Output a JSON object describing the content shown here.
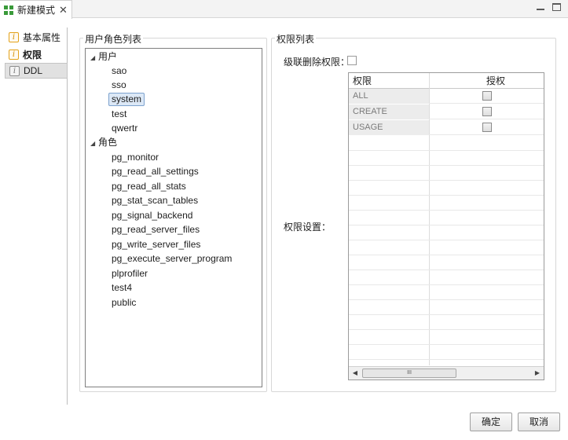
{
  "tab": {
    "title": "新建模式",
    "close": "✕"
  },
  "nav": {
    "items": [
      {
        "label": "基本属性"
      },
      {
        "label": "权限"
      },
      {
        "label": "DDL"
      }
    ]
  },
  "user_role_panel": {
    "title": "用户角色列表",
    "users_label": "用户",
    "users": [
      "sao",
      "sso",
      "system",
      "test",
      "qwertr"
    ],
    "selected_user": "system",
    "roles_label": "角色",
    "roles": [
      "pg_monitor",
      "pg_read_all_settings",
      "pg_read_all_stats",
      "pg_stat_scan_tables",
      "pg_signal_backend",
      "pg_read_server_files",
      "pg_write_server_files",
      "pg_execute_server_program",
      "plprofiler",
      "test4",
      "public"
    ]
  },
  "perm_panel": {
    "title": "权限列表",
    "cascade_label": "级联删除权限：",
    "cascade_checked": false,
    "settings_label": "权限设置：",
    "columns": [
      "权限",
      "授权"
    ],
    "rows": [
      {
        "name": "ALL",
        "granted": false
      },
      {
        "name": "CREATE",
        "granted": false
      },
      {
        "name": "USAGE",
        "granted": false
      }
    ],
    "scroll_thumb": "III"
  },
  "buttons": {
    "ok": "确定",
    "cancel": "取消"
  }
}
